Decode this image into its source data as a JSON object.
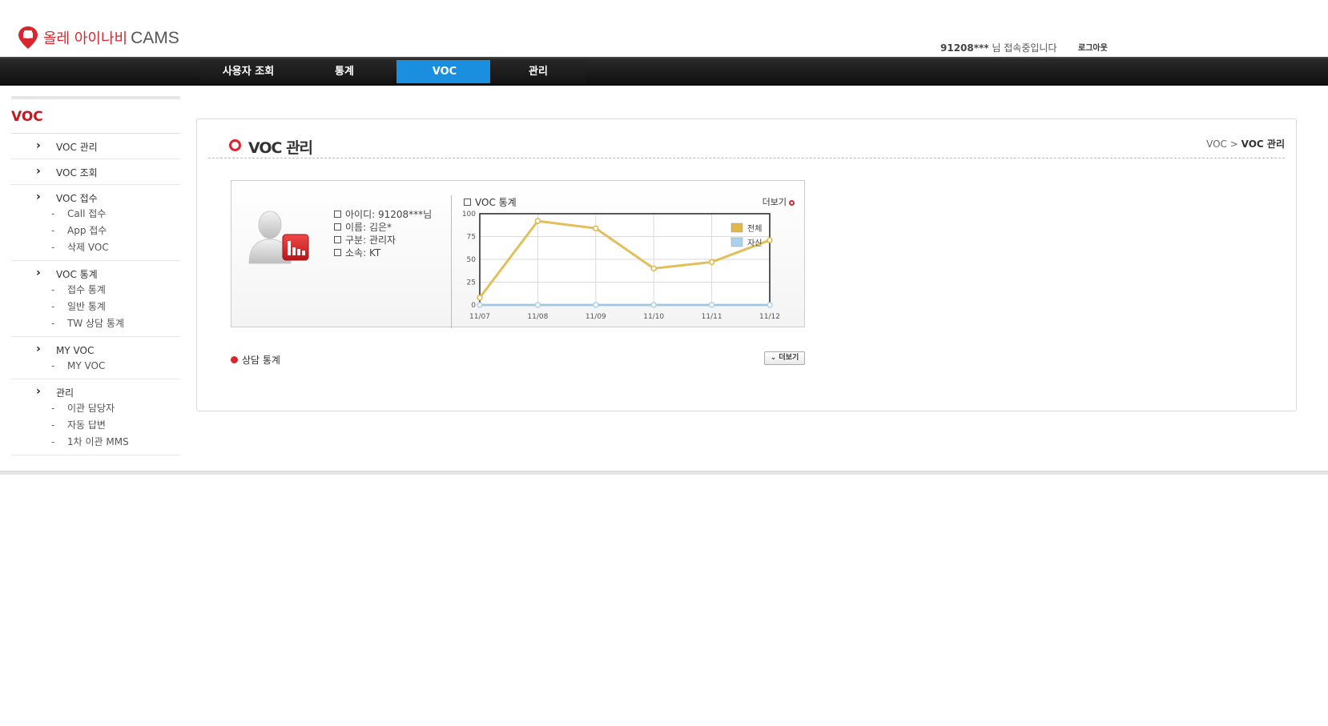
{
  "header": {
    "logo_text": "올레 아이나비",
    "logo_cams": "CAMS",
    "user_id": "91208***",
    "user_suffix": "님 접속중입니다",
    "logout": "로그아웃"
  },
  "nav": {
    "items": [
      "사용자 조회",
      "통계",
      "VOC",
      "관리"
    ],
    "active": "VOC"
  },
  "sidebar": {
    "title": "VOC",
    "groups": [
      {
        "label": "VOC 관리",
        "subs": []
      },
      {
        "label": "VOC 조회",
        "subs": []
      },
      {
        "label": "VOC 접수",
        "subs": [
          "Call 접수",
          "App 접수",
          "삭제 VOC"
        ]
      },
      {
        "label": "VOC 통계",
        "subs": [
          "접수 통계",
          "일반 통계",
          "TW 상담 통계"
        ]
      },
      {
        "label": "MY VOC",
        "subs": [
          "MY VOC"
        ]
      },
      {
        "label": "관리",
        "subs": [
          "이관 담당자",
          "자동 답변",
          "1차 이관 MMS"
        ]
      }
    ]
  },
  "page": {
    "title": "VOC 관리",
    "breadcrumb_root": "VOC",
    "breadcrumb_sep": ">",
    "breadcrumb_current": "VOC 관리"
  },
  "profile": {
    "id_line": "아이디: 91208***님",
    "name_line": "이름: 김은*",
    "type_line": "구분: 관리자",
    "org_line": "소속: KT"
  },
  "chart_panel": {
    "title": "VOC 통계",
    "more_label": "더보기"
  },
  "chart_data": {
    "type": "line",
    "x": [
      "11/07",
      "11/08",
      "11/09",
      "11/10",
      "11/11",
      "11/12"
    ],
    "ylim": [
      0,
      100
    ],
    "yticks": [
      0,
      25,
      50,
      75,
      100
    ],
    "grid": true,
    "legend_position": "top-right",
    "series": [
      {
        "name": "전체",
        "color": "#e0b84a",
        "values": [
          8,
          92,
          84,
          40,
          47,
          71
        ]
      },
      {
        "name": "자신",
        "color": "#a9d2ef",
        "values": [
          0,
          0,
          0,
          0,
          0,
          0
        ]
      }
    ]
  },
  "consult": {
    "title": "상담 통계",
    "more_button": "더보기"
  }
}
